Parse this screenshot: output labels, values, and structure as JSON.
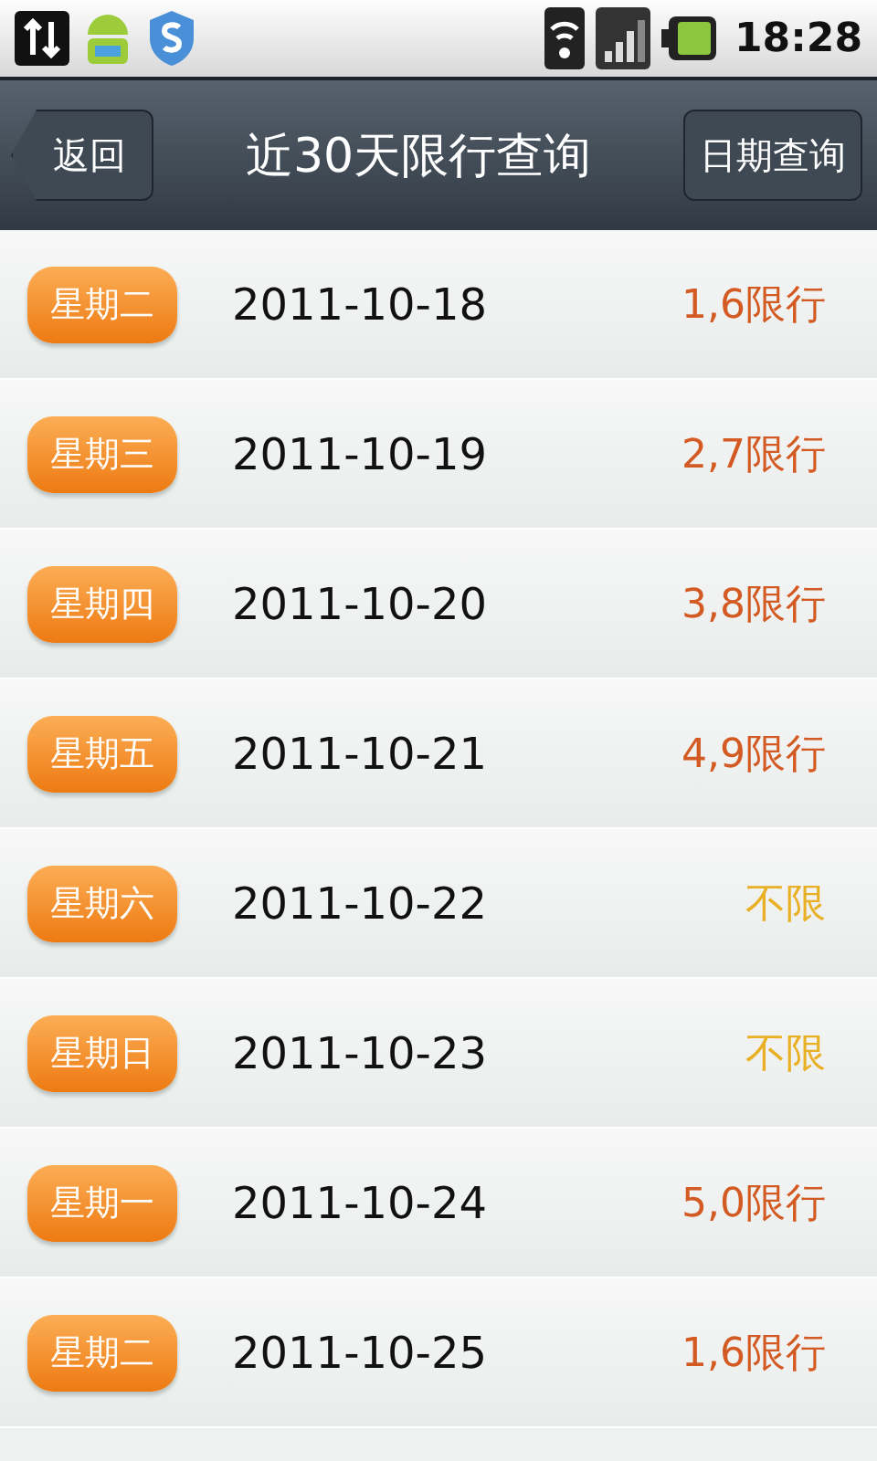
{
  "status_bar": {
    "time": "18:28"
  },
  "title_bar": {
    "back": "返回",
    "title": "近30天限行查询",
    "action": "日期查询"
  },
  "rows": [
    {
      "weekday": "星期二",
      "date": "2011-10-18",
      "rule": "1,6限行",
      "kind": "restricted"
    },
    {
      "weekday": "星期三",
      "date": "2011-10-19",
      "rule": "2,7限行",
      "kind": "restricted"
    },
    {
      "weekday": "星期四",
      "date": "2011-10-20",
      "rule": "3,8限行",
      "kind": "restricted"
    },
    {
      "weekday": "星期五",
      "date": "2011-10-21",
      "rule": "4,9限行",
      "kind": "restricted"
    },
    {
      "weekday": "星期六",
      "date": "2011-10-22",
      "rule": "不限",
      "kind": "free"
    },
    {
      "weekday": "星期日",
      "date": "2011-10-23",
      "rule": "不限",
      "kind": "free"
    },
    {
      "weekday": "星期一",
      "date": "2011-10-24",
      "rule": "5,0限行",
      "kind": "restricted"
    },
    {
      "weekday": "星期二",
      "date": "2011-10-25",
      "rule": "1,6限行",
      "kind": "restricted"
    }
  ]
}
